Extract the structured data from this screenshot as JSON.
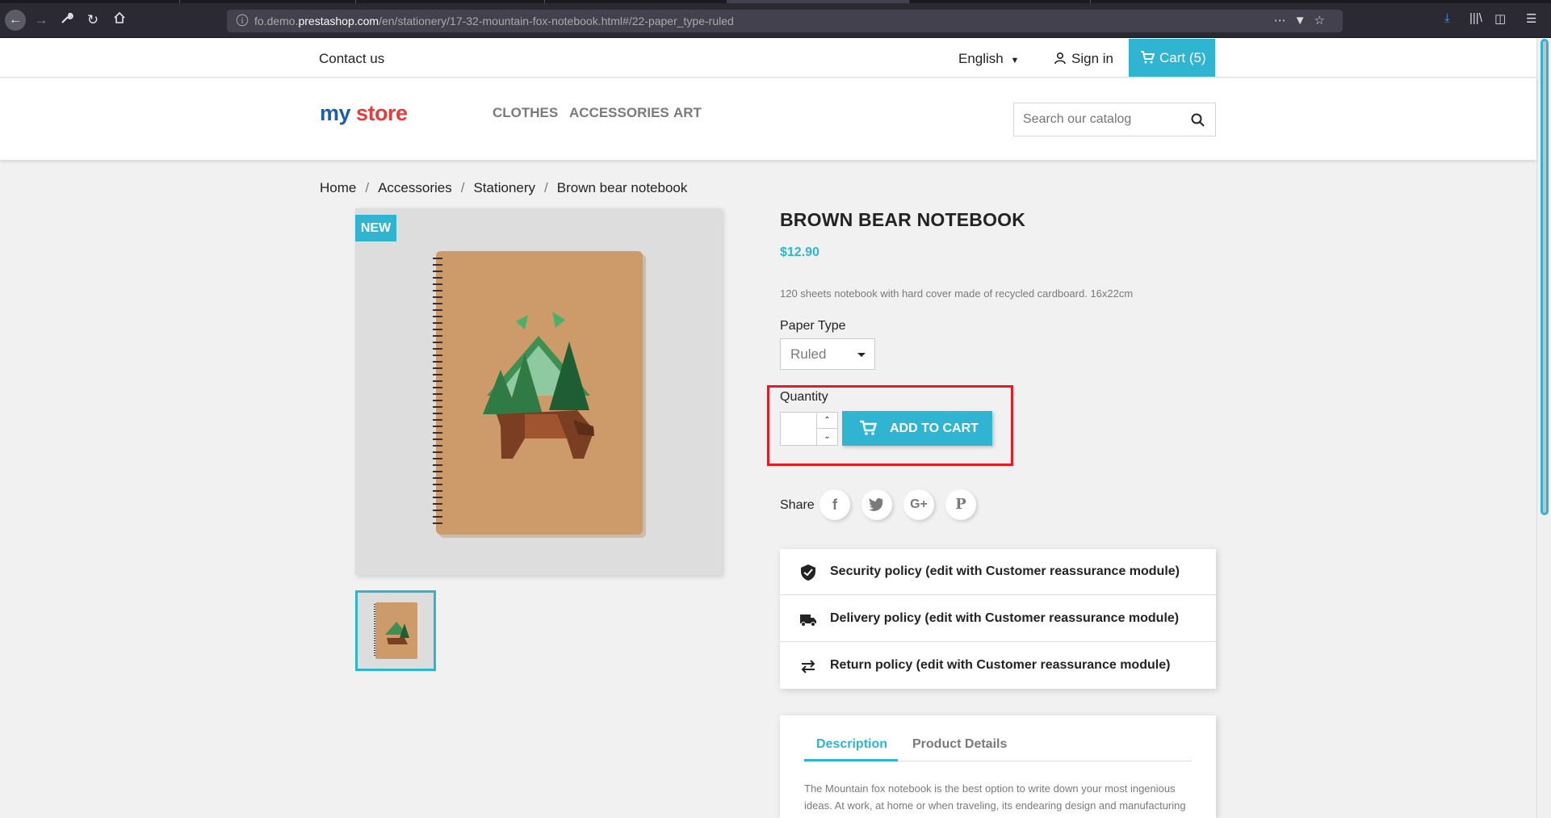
{
  "browser": {
    "url_prefix": "fo.demo.",
    "url_host": "prestashop.com",
    "url_path": "/en/stationery/17-32-mountain-fox-notebook.html#/22-paper_type-ruled"
  },
  "topbar": {
    "contact": "Contact us",
    "language": "English",
    "signin": "Sign in",
    "cart": "Cart (5)"
  },
  "logo": {
    "my": "my",
    "store": "store"
  },
  "nav": [
    "CLOTHES",
    "ACCESSORIES",
    "ART"
  ],
  "search": {
    "placeholder": "Search our catalog"
  },
  "breadcrumb": [
    "Home",
    "Accessories",
    "Stationery",
    "Brown bear notebook"
  ],
  "product": {
    "flag": "NEW",
    "title": "BROWN BEAR NOTEBOOK",
    "price": "$12.90",
    "short_description": "120 sheets notebook with hard cover made of recycled cardboard. 16x22cm",
    "paper_type_label": "Paper Type",
    "paper_type_value": "Ruled",
    "quantity_label": "Quantity",
    "quantity_value": "",
    "add_to_cart": "ADD TO CART",
    "share_label": "Share"
  },
  "share_buttons": [
    {
      "name": "facebook",
      "glyph": "f"
    },
    {
      "name": "twitter",
      "glyph": "t"
    },
    {
      "name": "googleplus",
      "glyph": "G+"
    },
    {
      "name": "pinterest",
      "glyph": "P"
    }
  ],
  "reassurance": [
    {
      "icon": "shield-icon",
      "text": "Security policy (edit with Customer reassurance module)"
    },
    {
      "icon": "truck-icon",
      "text": "Delivery policy (edit with Customer reassurance module)"
    },
    {
      "icon": "swap-arrows-icon",
      "text": "Return policy (edit with Customer reassurance module)"
    }
  ],
  "tabs": {
    "description": "Description",
    "details": "Product Details",
    "description_text": "The Mountain fox notebook is the best option to write down your most ingenious ideas. At work, at home or when traveling, its endearing design and manufacturing"
  },
  "colors": {
    "accent": "#2fb5d2",
    "highlight": "#e31b23",
    "text": "#232323",
    "muted": "#7a7a7a"
  }
}
